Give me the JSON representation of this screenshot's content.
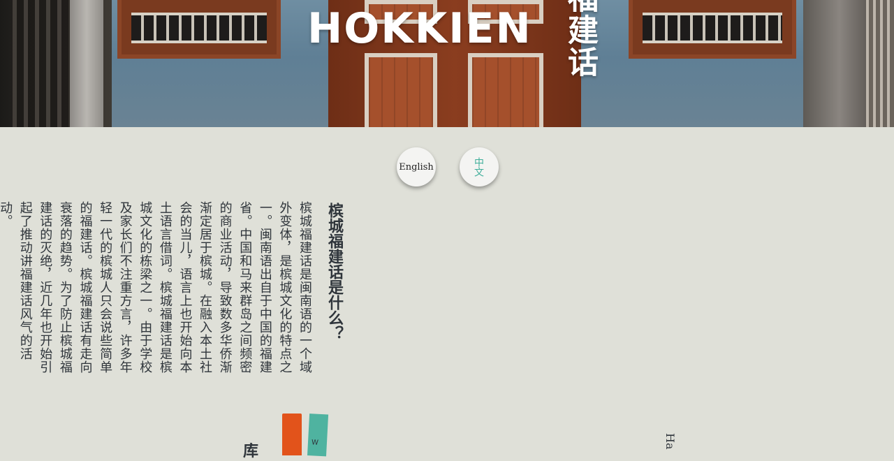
{
  "hero": {
    "title": "HOKKIEN",
    "title_cn": "福建话"
  },
  "lang_switch": {
    "english_label": "English",
    "chinese_label": "中文",
    "active_color": "#3fae9a"
  },
  "article": {
    "heading": "槟城福建话是什么？",
    "body": "槟城福建话是闽南语的一个域外变体，是槟城文化的特点之一。闽南语出自于中国的福建省。中国和马来群岛之间频密的商业活动，导致数多华侨渐渐定居于槟城。在融入本土社会的当儿，语言上也开始向本土语言借词。槟城福建话是槟城文化的栋梁之一。由于学校及家长们不注重方言，许多年轻一代的槟城人只会说些简单的福建话。槟城福建话有走向衰落的趋势。为了防止槟城福建话的灭绝，近几年也开始引起了推动讲福建话风气的活动。"
  },
  "bottom": {
    "heading_partial": "库",
    "book_spine_letter": "W",
    "english_partial": "Ha"
  }
}
